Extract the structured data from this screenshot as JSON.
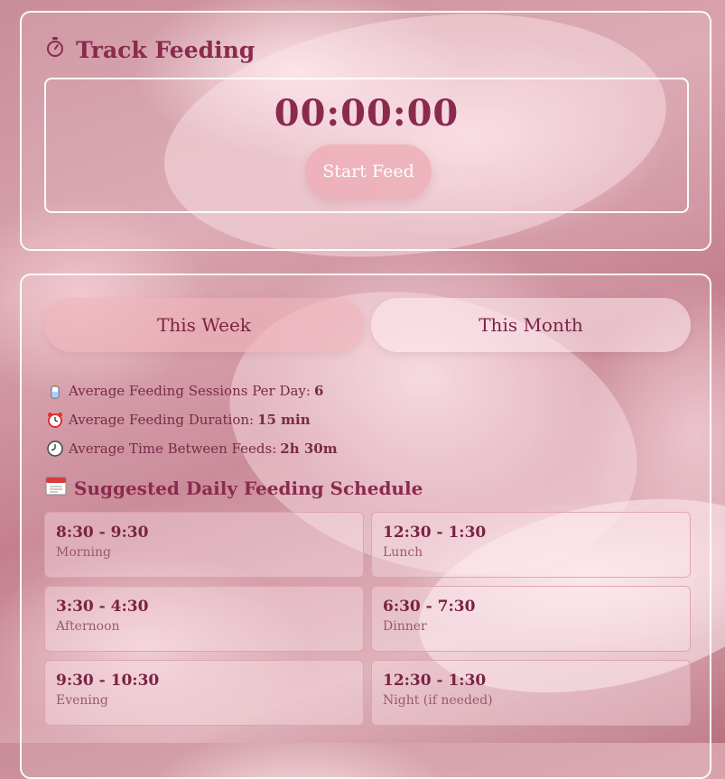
{
  "track": {
    "title": "Track Feeding",
    "icon": "stopwatch-icon",
    "timer": "00:00:00",
    "start_label": "Start Feed"
  },
  "tabs": [
    {
      "label": "This Week",
      "active": true
    },
    {
      "label": "This Month",
      "active": false
    }
  ],
  "stats": [
    {
      "icon": "baby-bottle-icon",
      "label": "Average Feeding Sessions Per Day:",
      "value": "6"
    },
    {
      "icon": "alarm-clock-icon",
      "label": "Average Feeding Duration:",
      "value": "15 min"
    },
    {
      "icon": "clock-icon",
      "label": "Average Time Between Feeds:",
      "value": "2h 30m"
    }
  ],
  "schedule": {
    "title": "Suggested Daily Feeding Schedule",
    "icon": "calendar-icon",
    "slots": [
      {
        "time": "8:30 - 9:30",
        "label": "Morning"
      },
      {
        "time": "12:30 - 1:30",
        "label": "Lunch"
      },
      {
        "time": "3:30 - 4:30",
        "label": "Afternoon"
      },
      {
        "time": "6:30 - 7:30",
        "label": "Dinner"
      },
      {
        "time": "9:30 - 10:30",
        "label": "Evening"
      },
      {
        "time": "12:30 - 1:30",
        "label": "Night (if needed)"
      }
    ]
  },
  "colors": {
    "accent": "#8a2a4e",
    "button": "#ecaab4",
    "border": "#ffffff"
  }
}
